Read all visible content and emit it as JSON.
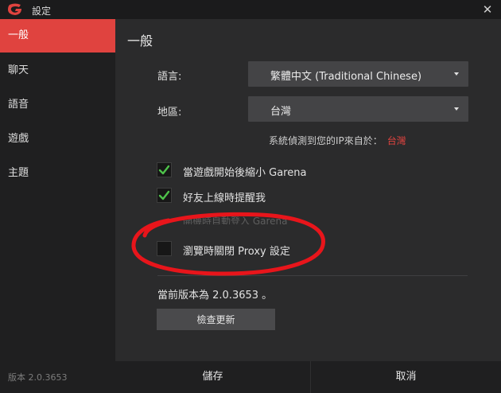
{
  "window": {
    "title": "設定",
    "close_symbol": "✕"
  },
  "sidebar": {
    "items": [
      {
        "label": "一般",
        "active": true
      },
      {
        "label": "聊天",
        "active": false
      },
      {
        "label": "語音",
        "active": false
      },
      {
        "label": "遊戲",
        "active": false
      },
      {
        "label": "主題",
        "active": false
      }
    ],
    "version": "版本 2.0.3653"
  },
  "main": {
    "title": "一般",
    "language": {
      "label": "語言:",
      "value": "繁體中文 (Traditional Chinese)"
    },
    "region": {
      "label": "地區:",
      "value": "台灣"
    },
    "ip_detect": {
      "text": "系統偵測到您的IP來自於：",
      "country": "台灣"
    },
    "options": [
      {
        "label": "當遊戲開始後縮小 Garena",
        "checked": true
      },
      {
        "label": "好友上線時提醒我",
        "checked": true
      },
      {
        "label": "瀏覽時關閉 Proxy 設定",
        "checked": false
      }
    ],
    "hidden_option": "開機時自動登入 Garena",
    "version_text": "當前版本為 2.0.3653 。",
    "update_button": "檢查更新"
  },
  "footer": {
    "save": "儲存",
    "cancel": "取消"
  },
  "colors": {
    "accent": "#e0433f",
    "check": "#4ec24a",
    "annotation": "#e8151b"
  }
}
